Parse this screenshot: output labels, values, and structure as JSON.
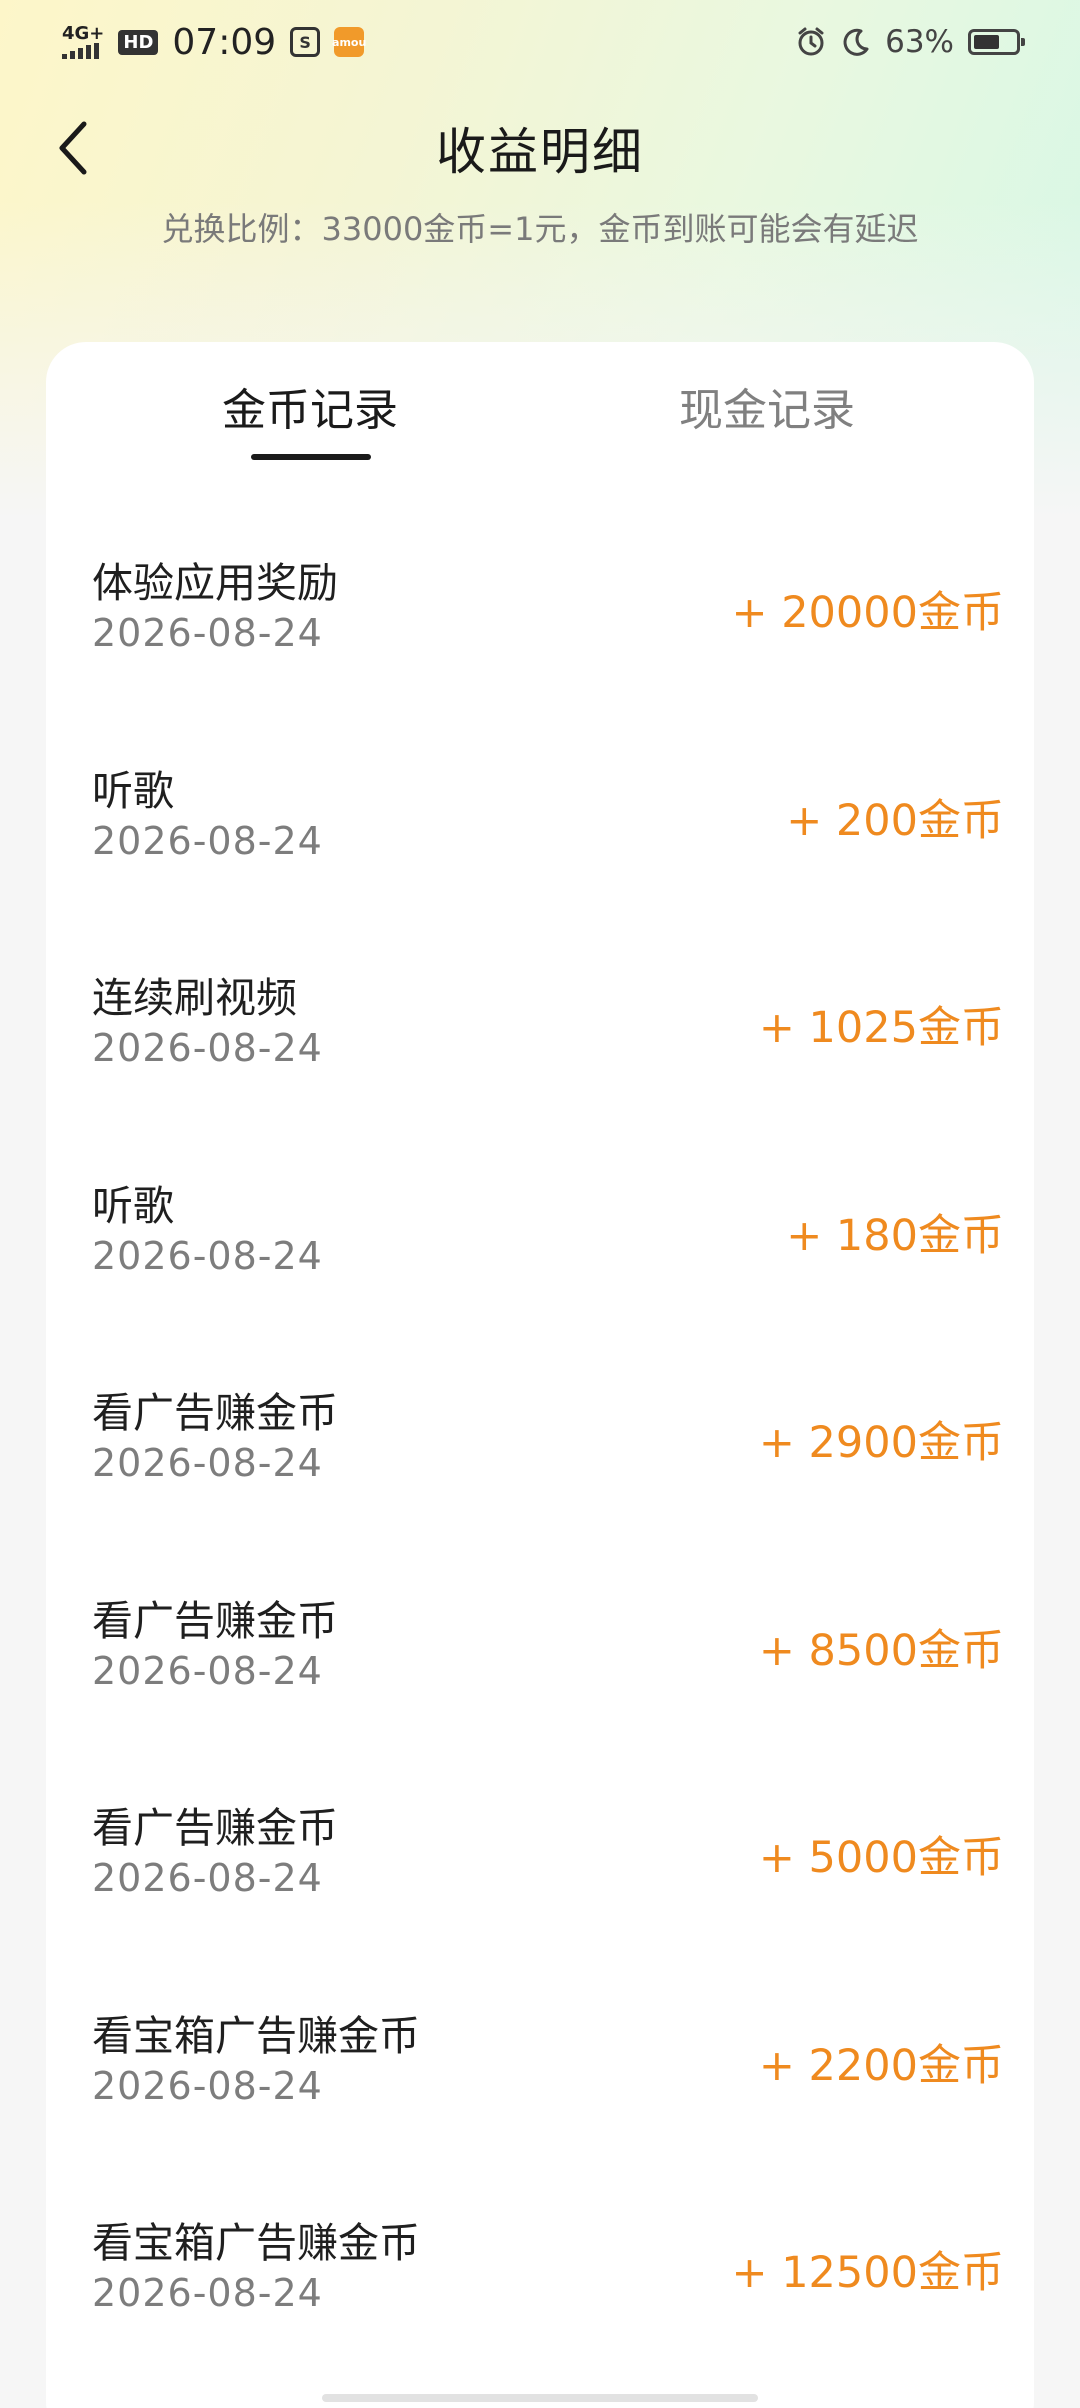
{
  "status_bar": {
    "network": "4G+",
    "hd": "HD",
    "time": "07:09",
    "app_icon_2": "amou",
    "battery_percent": "63%",
    "battery_level": 0.63
  },
  "header": {
    "title": "收益明细",
    "subtitle": "兑换比例：33000金币=1元，金币到账可能会有延迟"
  },
  "tabs": [
    {
      "label": "金币记录",
      "active": true
    },
    {
      "label": "现金记录",
      "active": false
    }
  ],
  "records": [
    {
      "name": "体验应用奖励",
      "date": "2026-08-24",
      "amount": "+ 20000金币"
    },
    {
      "name": "听歌",
      "date": "2026-08-24",
      "amount": "+ 200金币"
    },
    {
      "name": "连续刷视频",
      "date": "2026-08-24",
      "amount": "+ 1025金币"
    },
    {
      "name": "听歌",
      "date": "2026-08-24",
      "amount": "+ 180金币"
    },
    {
      "name": "看广告赚金币",
      "date": "2026-08-24",
      "amount": "+ 2900金币"
    },
    {
      "name": "看广告赚金币",
      "date": "2026-08-24",
      "amount": "+ 8500金币"
    },
    {
      "name": "看广告赚金币",
      "date": "2026-08-24",
      "amount": "+ 5000金币"
    },
    {
      "name": "看宝箱广告赚金币",
      "date": "2026-08-24",
      "amount": "+ 2200金币"
    },
    {
      "name": "看宝箱广告赚金币",
      "date": "2026-08-24",
      "amount": "+ 12500金币"
    }
  ],
  "colors": {
    "accent": "#ef8a1f",
    "text_primary": "#1f1f1f",
    "text_secondary": "#7d7d7d"
  }
}
